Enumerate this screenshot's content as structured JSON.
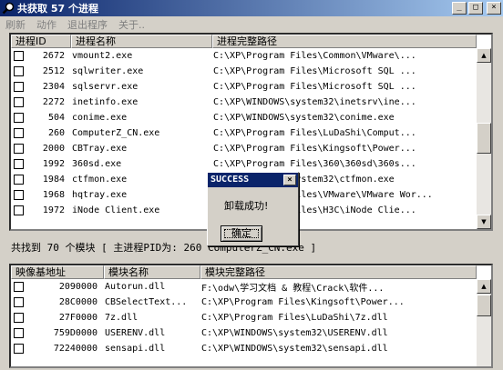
{
  "window": {
    "title": "共获取 57 个进程",
    "caption_buttons": [
      "_",
      "□",
      "×"
    ]
  },
  "menu": [
    "刷新",
    "动作",
    "退出程序",
    "关于.."
  ],
  "process_list": {
    "columns": [
      "进程ID",
      "进程名称",
      "进程完整路径"
    ],
    "rows": [
      {
        "pid": "2672",
        "name": "vmount2.exe",
        "path": "C:\\XP\\Program Files\\Common\\VMware\\..."
      },
      {
        "pid": "2512",
        "name": "sqlwriter.exe",
        "path": "C:\\XP\\Program Files\\Microsoft SQL ..."
      },
      {
        "pid": "2304",
        "name": "sqlservr.exe",
        "path": "C:\\XP\\Program Files\\Microsoft SQL ..."
      },
      {
        "pid": "2272",
        "name": "inetinfo.exe",
        "path": "C:\\XP\\WINDOWS\\system32\\inetsrv\\ine..."
      },
      {
        "pid": "504",
        "name": "conime.exe",
        "path": "C:\\XP\\WINDOWS\\system32\\conime.exe"
      },
      {
        "pid": "260",
        "name": "ComputerZ_CN.exe",
        "path": "C:\\XP\\Program Files\\LuDaShi\\Comput..."
      },
      {
        "pid": "2000",
        "name": "CBTray.exe",
        "path": "C:\\XP\\Program Files\\Kingsoft\\Power..."
      },
      {
        "pid": "1992",
        "name": "360sd.exe",
        "path": "C:\\XP\\Program Files\\360\\360sd\\360s..."
      },
      {
        "pid": "1984",
        "name": "ctfmon.exe",
        "path": "C:\\XP\\WINDOWS\\system32\\ctfmon.exe"
      },
      {
        "pid": "1968",
        "name": "hqtray.exe",
        "path": "C:\\XP\\Program Files\\VMware\\VMware Wor..."
      },
      {
        "pid": "1972",
        "name": "iNode Client.exe",
        "path": "C:\\XP\\Program Files\\H3C\\iNode Clie..."
      }
    ]
  },
  "status": "共找到 70 个模块 [ 主进程PID为: 260   ComputerZ_CN.exe ]",
  "module_list": {
    "columns": [
      "映像基地址",
      "模块名称",
      "模块完整路径"
    ],
    "rows": [
      {
        "base": "2090000",
        "name": "Autorun.dll",
        "path": "F:\\odw\\学习文档 & 教程\\Crack\\软件..."
      },
      {
        "base": "28C0000",
        "name": "CBSelectText...",
        "path": "C:\\XP\\Program Files\\Kingsoft\\Power..."
      },
      {
        "base": "27F0000",
        "name": "7z.dll",
        "path": "C:\\XP\\Program Files\\LuDaShi\\7z.dll"
      },
      {
        "base": "759D0000",
        "name": "USERENV.dll",
        "path": "C:\\XP\\WINDOWS\\system32\\USERENV.dll"
      },
      {
        "base": "72240000",
        "name": "sensapi.dll",
        "path": "C:\\XP\\WINDOWS\\system32\\sensapi.dll"
      }
    ]
  },
  "dialog": {
    "title": "SUCCESS",
    "message": "卸载成功!",
    "ok_label": "确定"
  },
  "colors": {
    "titlebar": "#0a246a",
    "face": "#d4d0c8",
    "window": "#ffffff"
  }
}
